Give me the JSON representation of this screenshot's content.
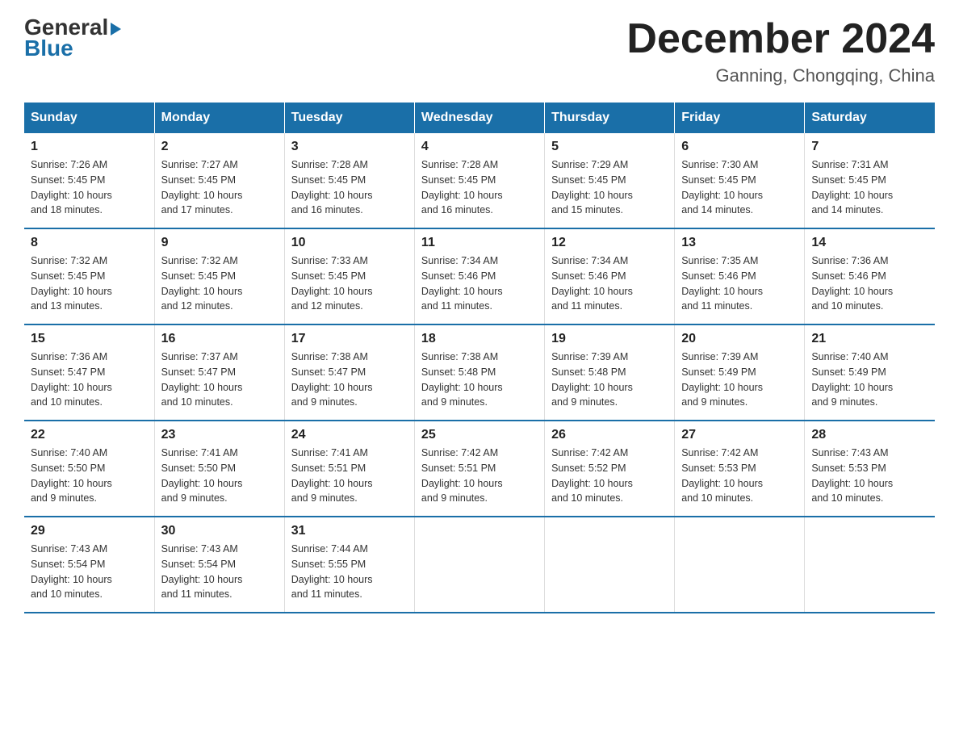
{
  "logo": {
    "general": "General",
    "blue": "Blue",
    "arrow": "▶"
  },
  "header": {
    "month_year": "December 2024",
    "location": "Ganning, Chongqing, China"
  },
  "days_of_week": [
    "Sunday",
    "Monday",
    "Tuesday",
    "Wednesday",
    "Thursday",
    "Friday",
    "Saturday"
  ],
  "weeks": [
    [
      {
        "day": "1",
        "sunrise": "7:26 AM",
        "sunset": "5:45 PM",
        "daylight": "10 hours and 18 minutes."
      },
      {
        "day": "2",
        "sunrise": "7:27 AM",
        "sunset": "5:45 PM",
        "daylight": "10 hours and 17 minutes."
      },
      {
        "day": "3",
        "sunrise": "7:28 AM",
        "sunset": "5:45 PM",
        "daylight": "10 hours and 16 minutes."
      },
      {
        "day": "4",
        "sunrise": "7:28 AM",
        "sunset": "5:45 PM",
        "daylight": "10 hours and 16 minutes."
      },
      {
        "day": "5",
        "sunrise": "7:29 AM",
        "sunset": "5:45 PM",
        "daylight": "10 hours and 15 minutes."
      },
      {
        "day": "6",
        "sunrise": "7:30 AM",
        "sunset": "5:45 PM",
        "daylight": "10 hours and 14 minutes."
      },
      {
        "day": "7",
        "sunrise": "7:31 AM",
        "sunset": "5:45 PM",
        "daylight": "10 hours and 14 minutes."
      }
    ],
    [
      {
        "day": "8",
        "sunrise": "7:32 AM",
        "sunset": "5:45 PM",
        "daylight": "10 hours and 13 minutes."
      },
      {
        "day": "9",
        "sunrise": "7:32 AM",
        "sunset": "5:45 PM",
        "daylight": "10 hours and 12 minutes."
      },
      {
        "day": "10",
        "sunrise": "7:33 AM",
        "sunset": "5:45 PM",
        "daylight": "10 hours and 12 minutes."
      },
      {
        "day": "11",
        "sunrise": "7:34 AM",
        "sunset": "5:46 PM",
        "daylight": "10 hours and 11 minutes."
      },
      {
        "day": "12",
        "sunrise": "7:34 AM",
        "sunset": "5:46 PM",
        "daylight": "10 hours and 11 minutes."
      },
      {
        "day": "13",
        "sunrise": "7:35 AM",
        "sunset": "5:46 PM",
        "daylight": "10 hours and 11 minutes."
      },
      {
        "day": "14",
        "sunrise": "7:36 AM",
        "sunset": "5:46 PM",
        "daylight": "10 hours and 10 minutes."
      }
    ],
    [
      {
        "day": "15",
        "sunrise": "7:36 AM",
        "sunset": "5:47 PM",
        "daylight": "10 hours and 10 minutes."
      },
      {
        "day": "16",
        "sunrise": "7:37 AM",
        "sunset": "5:47 PM",
        "daylight": "10 hours and 10 minutes."
      },
      {
        "day": "17",
        "sunrise": "7:38 AM",
        "sunset": "5:47 PM",
        "daylight": "10 hours and 9 minutes."
      },
      {
        "day": "18",
        "sunrise": "7:38 AM",
        "sunset": "5:48 PM",
        "daylight": "10 hours and 9 minutes."
      },
      {
        "day": "19",
        "sunrise": "7:39 AM",
        "sunset": "5:48 PM",
        "daylight": "10 hours and 9 minutes."
      },
      {
        "day": "20",
        "sunrise": "7:39 AM",
        "sunset": "5:49 PM",
        "daylight": "10 hours and 9 minutes."
      },
      {
        "day": "21",
        "sunrise": "7:40 AM",
        "sunset": "5:49 PM",
        "daylight": "10 hours and 9 minutes."
      }
    ],
    [
      {
        "day": "22",
        "sunrise": "7:40 AM",
        "sunset": "5:50 PM",
        "daylight": "10 hours and 9 minutes."
      },
      {
        "day": "23",
        "sunrise": "7:41 AM",
        "sunset": "5:50 PM",
        "daylight": "10 hours and 9 minutes."
      },
      {
        "day": "24",
        "sunrise": "7:41 AM",
        "sunset": "5:51 PM",
        "daylight": "10 hours and 9 minutes."
      },
      {
        "day": "25",
        "sunrise": "7:42 AM",
        "sunset": "5:51 PM",
        "daylight": "10 hours and 9 minutes."
      },
      {
        "day": "26",
        "sunrise": "7:42 AM",
        "sunset": "5:52 PM",
        "daylight": "10 hours and 10 minutes."
      },
      {
        "day": "27",
        "sunrise": "7:42 AM",
        "sunset": "5:53 PM",
        "daylight": "10 hours and 10 minutes."
      },
      {
        "day": "28",
        "sunrise": "7:43 AM",
        "sunset": "5:53 PM",
        "daylight": "10 hours and 10 minutes."
      }
    ],
    [
      {
        "day": "29",
        "sunrise": "7:43 AM",
        "sunset": "5:54 PM",
        "daylight": "10 hours and 10 minutes."
      },
      {
        "day": "30",
        "sunrise": "7:43 AM",
        "sunset": "5:54 PM",
        "daylight": "10 hours and 11 minutes."
      },
      {
        "day": "31",
        "sunrise": "7:44 AM",
        "sunset": "5:55 PM",
        "daylight": "10 hours and 11 minutes."
      },
      null,
      null,
      null,
      null
    ]
  ],
  "labels": {
    "sunrise": "Sunrise:",
    "sunset": "Sunset:",
    "daylight": "Daylight:"
  }
}
